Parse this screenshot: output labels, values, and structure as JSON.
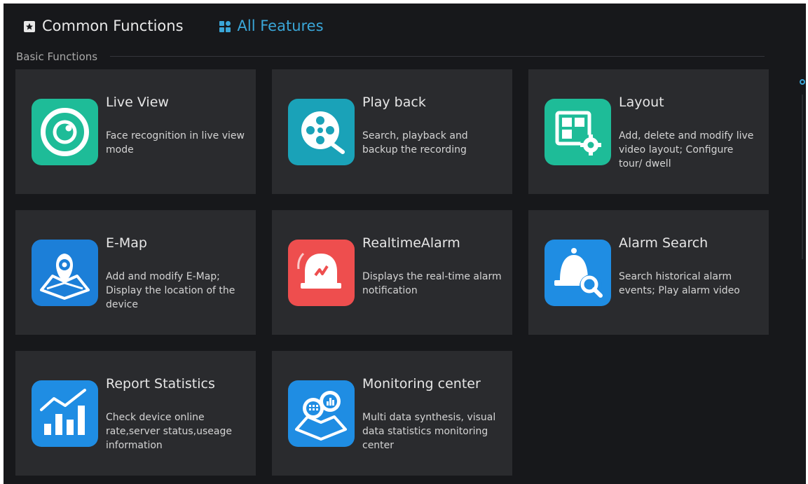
{
  "tabs": {
    "common": "Common Functions",
    "all": "All Features"
  },
  "section": {
    "title": "Basic Functions"
  },
  "cards": [
    {
      "title": "Live View",
      "desc": "Face recognition in live view mode",
      "icon": "live-view-icon",
      "color": "#1ebc98"
    },
    {
      "title": "Play back",
      "desc": "Search, playback and backup the recording",
      "icon": "playback-film-icon",
      "color": "#1aa2b8"
    },
    {
      "title": "Layout",
      "desc": "Add, delete and modify live video layout; Configure tour/ dwell",
      "icon": "layout-gear-icon",
      "color": "#1ebc98"
    },
    {
      "title": "E-Map",
      "desc": "Add and modify E-Map; Display the location of the device",
      "icon": "emap-icon",
      "color": "#1c7fd8"
    },
    {
      "title": "RealtimeAlarm",
      "desc": "Displays the real-time alarm notification",
      "icon": "alarm-bell-icon",
      "color": "#ee4e4e"
    },
    {
      "title": "Alarm Search",
      "desc": "Search historical alarm events; Play alarm video",
      "icon": "alarm-search-icon",
      "color": "#1f8de3"
    },
    {
      "title": "Report Statistics",
      "desc": "Check device online rate,server status,useage information",
      "icon": "report-chart-icon",
      "color": "#1f8de3"
    },
    {
      "title": "Monitoring center",
      "desc": "Multi data synthesis, visual data statistics monitoring center",
      "icon": "monitoring-center-icon",
      "color": "#1f8de3"
    }
  ],
  "colors": {
    "accent": "#3aa6d8",
    "background": "#17181b",
    "card": "#2a2b2e"
  }
}
